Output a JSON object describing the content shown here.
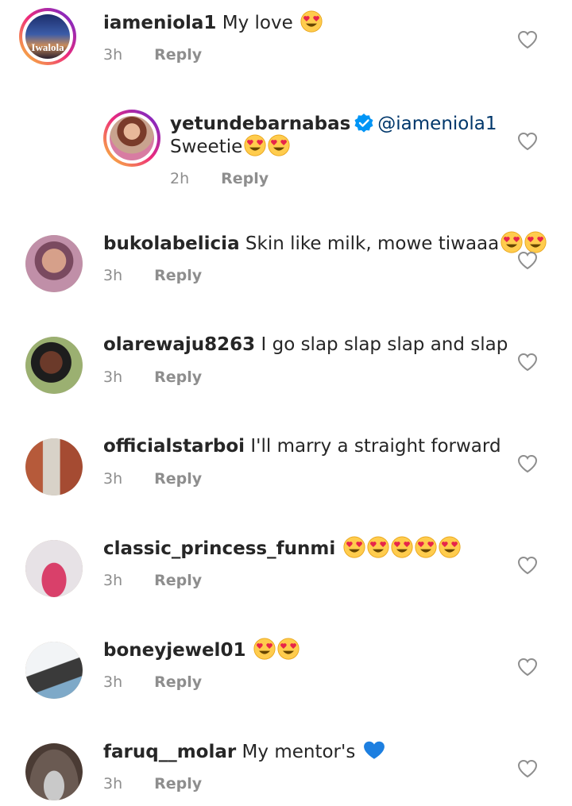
{
  "comments": [
    {
      "username": "iameniola1",
      "text": "My love",
      "emoji_count": 1,
      "time": "3h",
      "reply": "Reply",
      "avatar_caption": "Iwalola"
    },
    {
      "username": "yetundebarnabas",
      "mention": "@iameniola1",
      "text": "Sweetie",
      "emoji_count": 2,
      "time": "2h",
      "reply": "Reply",
      "verified": true
    },
    {
      "username": "bukolabelicia",
      "text": "Skin like milk, mowe tiwaaa",
      "emoji_count": 2,
      "time": "3h",
      "reply": "Reply"
    },
    {
      "username": "olarewaju8263",
      "text": "I go slap slap slap and slap",
      "emoji_count": 0,
      "time": "3h",
      "reply": "Reply"
    },
    {
      "username": "officialstarboi",
      "text": "I'll marry a straight forward",
      "emoji_count": 0,
      "time": "3h",
      "reply": "Reply"
    },
    {
      "username": "classic_princess_funmi",
      "text": "",
      "emoji_count": 5,
      "time": "3h",
      "reply": "Reply"
    },
    {
      "username": "boneyjewel01",
      "text": "",
      "emoji_count": 2,
      "time": "3h",
      "reply": "Reply"
    },
    {
      "username": "faruq__molar",
      "text": "My mentor's",
      "emoji": "blue-heart",
      "time": "3h",
      "reply": "Reply"
    }
  ],
  "colors": {
    "meta": "#8e8e8e",
    "mention": "#00376b",
    "verified": "#0095f6",
    "blue_heart": "#1d7fe0"
  },
  "icons": {
    "like": "heart-outline-icon",
    "verified": "verified-badge-icon",
    "emoji": "heart-eyes-emoji"
  }
}
